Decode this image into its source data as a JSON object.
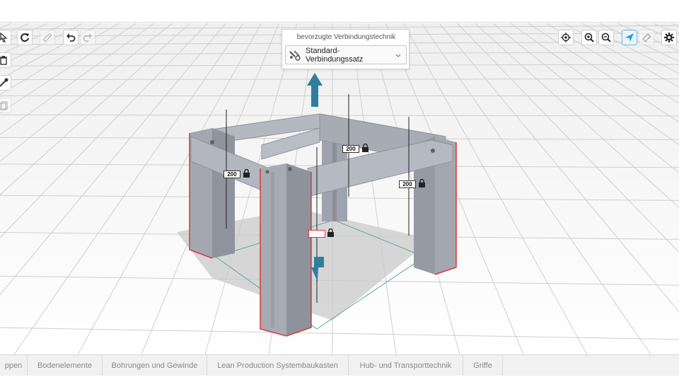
{
  "connection_panel": {
    "title": "bevorzugte Verbindungstechnik",
    "selected": "Standard-Verbindungssatz"
  },
  "dimensions": {
    "back": "200",
    "left": "200",
    "right": "200",
    "front": ""
  },
  "toolbar_left": [
    "cursor-icon",
    "reset-icon",
    "measure-icon",
    "undo-icon",
    "redo-icon"
  ],
  "toolbar_side": [
    "trash-icon",
    "pipette-icon",
    "copy-icon"
  ],
  "toolbar_right": [
    "target-icon",
    "zoom-in-icon",
    "zoom-out-icon",
    "send-icon",
    "eraser-icon",
    "gear-icon"
  ],
  "tabs": [
    "ppen",
    "Bodenelemente",
    "Bohrungen und Gewinde",
    "Lean Production Systembaukasten",
    "Hub- und Transporttechnik",
    "Griffe"
  ],
  "colors": {
    "accent": "#2a9fd6",
    "profile": "#a9adb6",
    "highlight": "#d83a3a",
    "arrow": "#2e7f9e"
  }
}
